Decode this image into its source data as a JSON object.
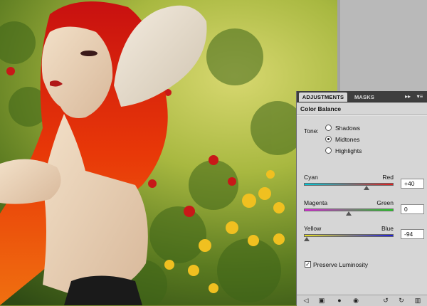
{
  "panel": {
    "tabs": [
      {
        "label": "ADJUSTMENTS",
        "active": true
      },
      {
        "label": "MASKS",
        "active": false
      }
    ],
    "expand_icon": "double-arrow-icon",
    "menu_icon": "panel-menu-icon",
    "title": "Color Balance",
    "tone": {
      "label": "Tone:",
      "options": [
        {
          "label": "Shadows",
          "selected": false
        },
        {
          "label": "Midtones",
          "selected": true
        },
        {
          "label": "Highlights",
          "selected": false
        }
      ]
    },
    "sliders": [
      {
        "left": "Cyan",
        "right": "Red",
        "value": "+40",
        "numeric": 40,
        "colors": [
          "#00c8d8",
          "#e02020"
        ]
      },
      {
        "left": "Magenta",
        "right": "Green",
        "value": "0",
        "numeric": 0,
        "colors": [
          "#e020e0",
          "#20d020"
        ]
      },
      {
        "left": "Yellow",
        "right": "Blue",
        "value": "-94",
        "numeric": -94,
        "colors": [
          "#e8e020",
          "#2020e0"
        ]
      }
    ],
    "preserve_luminosity": {
      "label": "Preserve Luminosity",
      "checked": true
    },
    "bottom_icons": [
      "return-arrow-icon",
      "clip-to-layer-icon",
      "eye-visibility-icon",
      "view-previous-icon",
      "reset-icon",
      "trash-icon"
    ]
  }
}
